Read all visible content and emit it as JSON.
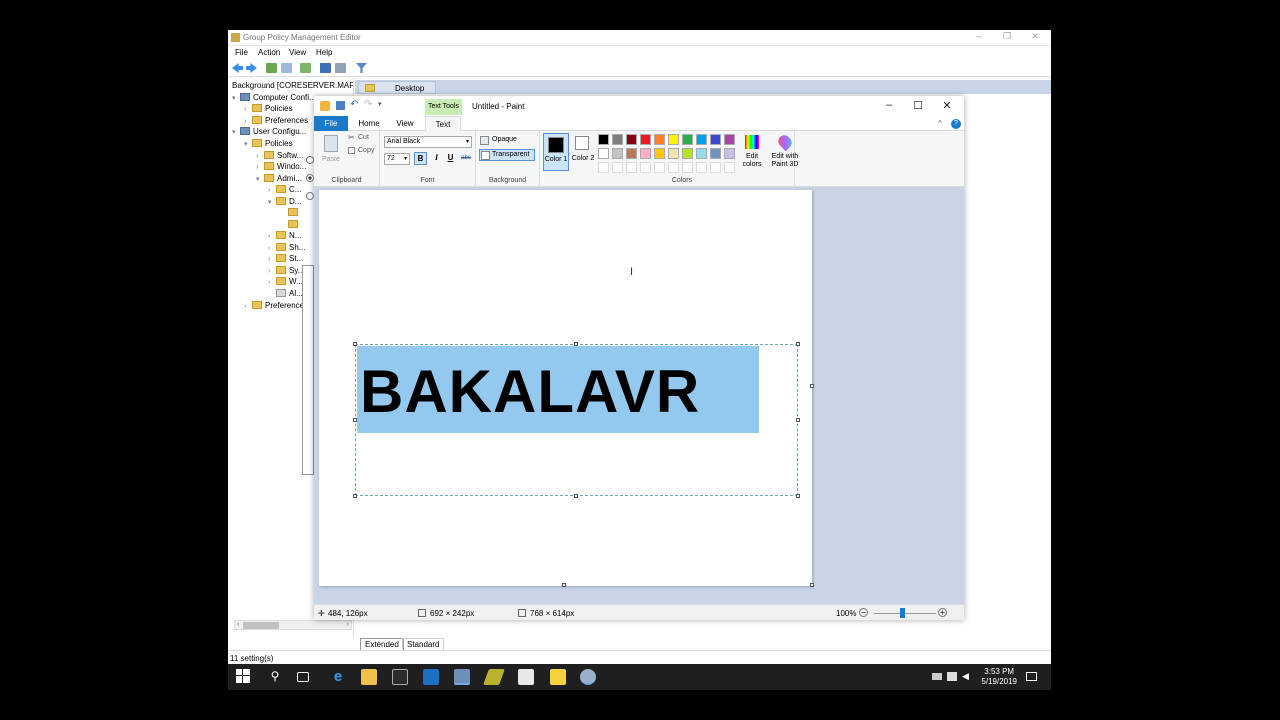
{
  "gpme": {
    "title": "Group Policy Management Editor",
    "menu": [
      "File",
      "Action",
      "View",
      "Help"
    ],
    "tree": [
      "Background [CORESERVER.MAF",
      "Computer Confi...",
      "Policies",
      "Preferences",
      "User Configu...",
      "Policies",
      "Softw...",
      "Windo...",
      "Admi...",
      "C...",
      "D...",
      "N...",
      "Sh...",
      "St...",
      "Sy...",
      "W...",
      "Al...",
      "Preferences"
    ],
    "desktop_tab": "Desktop",
    "bottom_tabs": [
      "Extended",
      "Standard"
    ],
    "status": "11 setting(s)",
    "window_controls": [
      "–",
      "❐",
      "✕"
    ]
  },
  "paint": {
    "title": "Untitled - Paint",
    "text_tools": "Text Tools",
    "tabs": [
      "File",
      "Home",
      "View",
      "Text"
    ],
    "clipboard": {
      "paste": "Paste",
      "cut": "Cut",
      "copy": "Copy",
      "label": "Clipboard"
    },
    "font": {
      "family": "Arial Black",
      "size": "72",
      "label": "Font",
      "bold": "B",
      "italic": "I",
      "underline": "U",
      "strike": "abc"
    },
    "background": {
      "opaque": "Opaque",
      "transparent": "Transparent",
      "label": "Background"
    },
    "colors": {
      "color1": "Color 1",
      "color2": "Color 2",
      "edit": "Edit colors",
      "paint3d": "Edit with Paint 3D",
      "label": "Colors",
      "palette_row1": [
        "#000000",
        "#7f7f7f",
        "#880015",
        "#ed1c24",
        "#ff7f27",
        "#fff200",
        "#22b14c",
        "#00a2e8",
        "#3f48cc",
        "#a349a4"
      ],
      "palette_row2": [
        "#ffffff",
        "#c3c3c3",
        "#b97a57",
        "#ffaec9",
        "#ffc90e",
        "#efe4b0",
        "#b5e61d",
        "#99d9ea",
        "#7092be",
        "#c8bfe7"
      ]
    },
    "canvas_text": "BAKALAVR",
    "status": {
      "pos": "484, 126px",
      "sel": "692 × 242px",
      "size": "768 × 614px",
      "zoom": "100%"
    },
    "controls": {
      "min": "–",
      "max": "☐",
      "close": "✕"
    }
  },
  "taskbar": {
    "time": "3:53 PM",
    "date": "5/19/2019"
  }
}
